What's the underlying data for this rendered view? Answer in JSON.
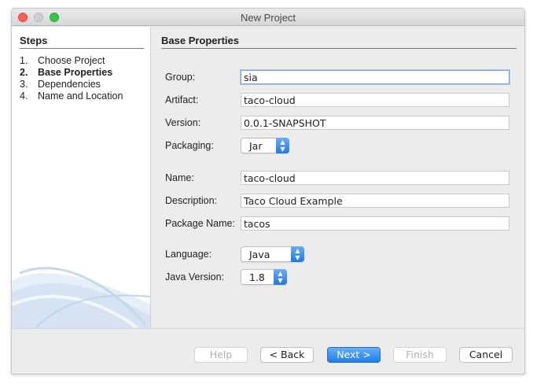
{
  "window": {
    "title": "New Project"
  },
  "steps": {
    "title": "Steps",
    "items": [
      {
        "num": "1.",
        "label": "Choose Project"
      },
      {
        "num": "2.",
        "label": "Base Properties"
      },
      {
        "num": "3.",
        "label": "Dependencies"
      },
      {
        "num": "4.",
        "label": "Name and Location"
      }
    ],
    "active_index": 1
  },
  "form": {
    "section_title": "Base Properties",
    "group": {
      "label": "Group:",
      "value": "sia"
    },
    "artifact": {
      "label": "Artifact:",
      "value": "taco-cloud"
    },
    "version": {
      "label": "Version:",
      "value": "0.0.1-SNAPSHOT"
    },
    "packaging": {
      "label": "Packaging:",
      "value": "Jar"
    },
    "name": {
      "label": "Name:",
      "value": "taco-cloud"
    },
    "description": {
      "label": "Description:",
      "value": "Taco Cloud Example"
    },
    "package_name": {
      "label": "Package Name:",
      "value": "tacos"
    },
    "language": {
      "label": "Language:",
      "value": "Java"
    },
    "java_version": {
      "label": "Java Version:",
      "value": "1.8"
    }
  },
  "buttons": {
    "help": "Help",
    "back": "< Back",
    "next": "Next >",
    "finish": "Finish",
    "cancel": "Cancel"
  },
  "colors": {
    "accent": "#1d7fee",
    "close": "#fc5f57",
    "maximize": "#34c749"
  }
}
